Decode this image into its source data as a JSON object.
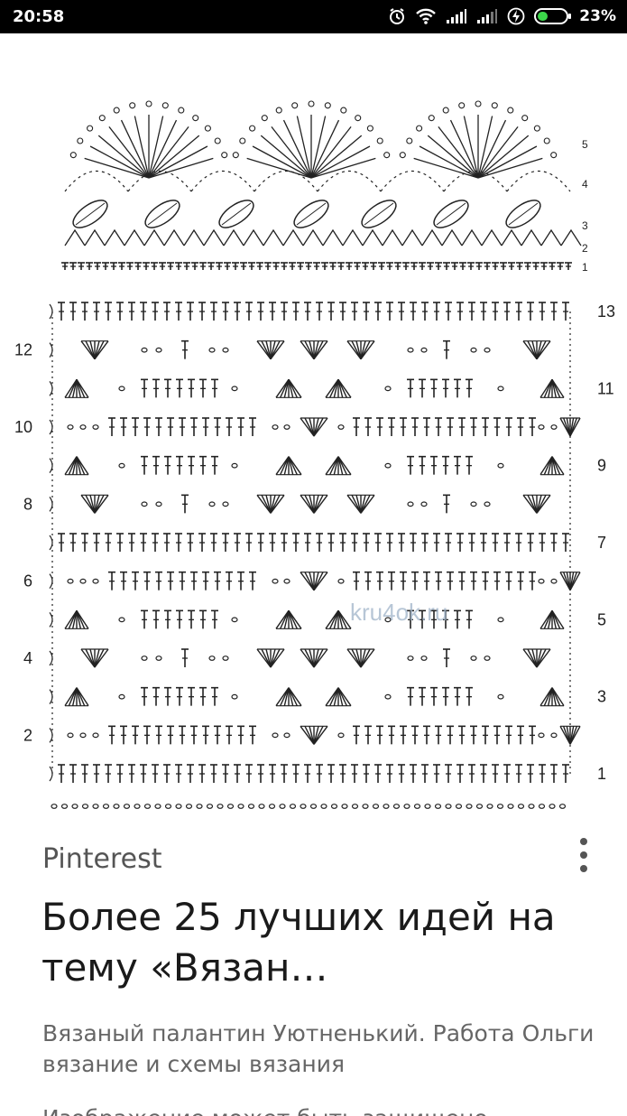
{
  "status_bar": {
    "time": "20:58",
    "battery_percent": "23%",
    "icons": [
      "alarm-icon",
      "wifi-icon",
      "signal-icon",
      "signal-icon-2",
      "charging-icon",
      "battery-icon"
    ]
  },
  "pattern_image": {
    "watermark": "kru4ok.ru",
    "edging_row_numbers": [
      "5",
      "4",
      "3",
      "2",
      "1"
    ],
    "main_row_numbers_left": [
      "12",
      "10",
      "8",
      "6",
      "4",
      "2"
    ],
    "main_row_numbers_right": [
      "13",
      "11",
      "9",
      "7",
      "5",
      "3",
      "1"
    ]
  },
  "card": {
    "source": "Pinterest",
    "title": "Более 25 лучших идей на тему «Вязан…",
    "description": "Вязаный палантин Уютненький. Работа Ольги вязание и схемы вязания",
    "notice": "Изображение может быть защищено"
  }
}
